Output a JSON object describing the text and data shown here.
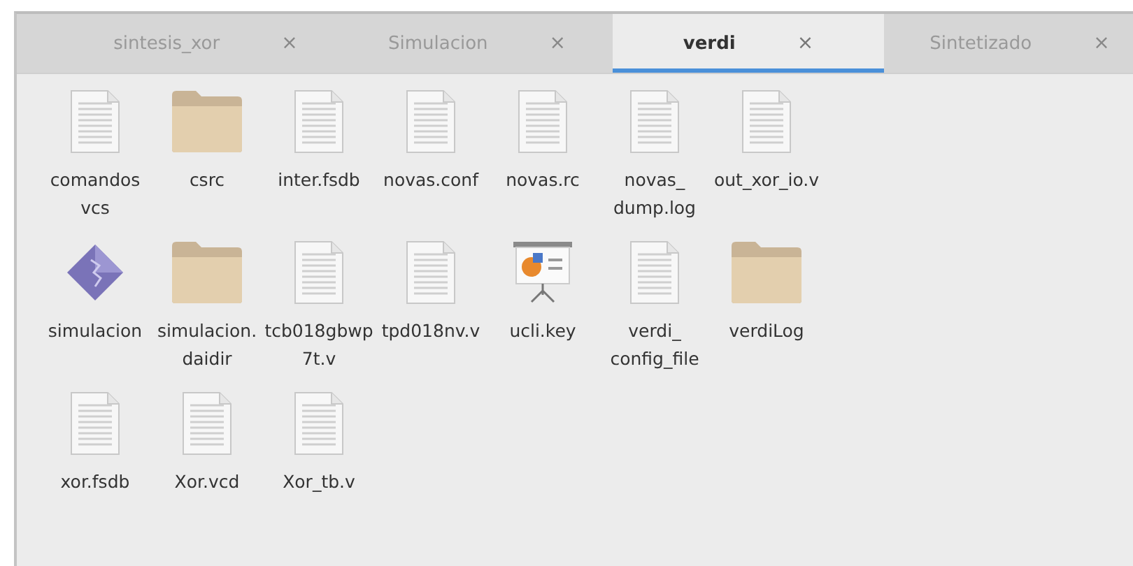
{
  "tabs": [
    {
      "label": "sintesis_xor",
      "close": "×",
      "selected": false
    },
    {
      "label": "Simulacion",
      "close": "×",
      "selected": false
    },
    {
      "label": "verdi",
      "close": "×",
      "selected": true
    },
    {
      "label": "Sintetizado",
      "close": "×",
      "selected": false
    }
  ],
  "files": [
    {
      "name": "comandos vcs",
      "kind": "file"
    },
    {
      "name": "csrc",
      "kind": "folder"
    },
    {
      "name": "inter.fsdb",
      "kind": "file"
    },
    {
      "name": "novas.conf",
      "kind": "file"
    },
    {
      "name": "novas.rc",
      "kind": "file"
    },
    {
      "name": "novas_ dump.log",
      "kind": "file"
    },
    {
      "name": "out_xor_io.v",
      "kind": "file"
    },
    {
      "name": "simulacion",
      "kind": "executable"
    },
    {
      "name": "simulacion. daidir",
      "kind": "folder"
    },
    {
      "name": "tcb018gbwp 7t.v",
      "kind": "file"
    },
    {
      "name": "tpd018nv.v",
      "kind": "file"
    },
    {
      "name": "ucli.key",
      "kind": "presentation"
    },
    {
      "name": "verdi_ config_file",
      "kind": "file"
    },
    {
      "name": "verdiLog",
      "kind": "folder"
    },
    {
      "name": "xor.fsdb",
      "kind": "file"
    },
    {
      "name": "Xor.vcd",
      "kind": "file"
    },
    {
      "name": "Xor_tb.v",
      "kind": "file"
    }
  ]
}
